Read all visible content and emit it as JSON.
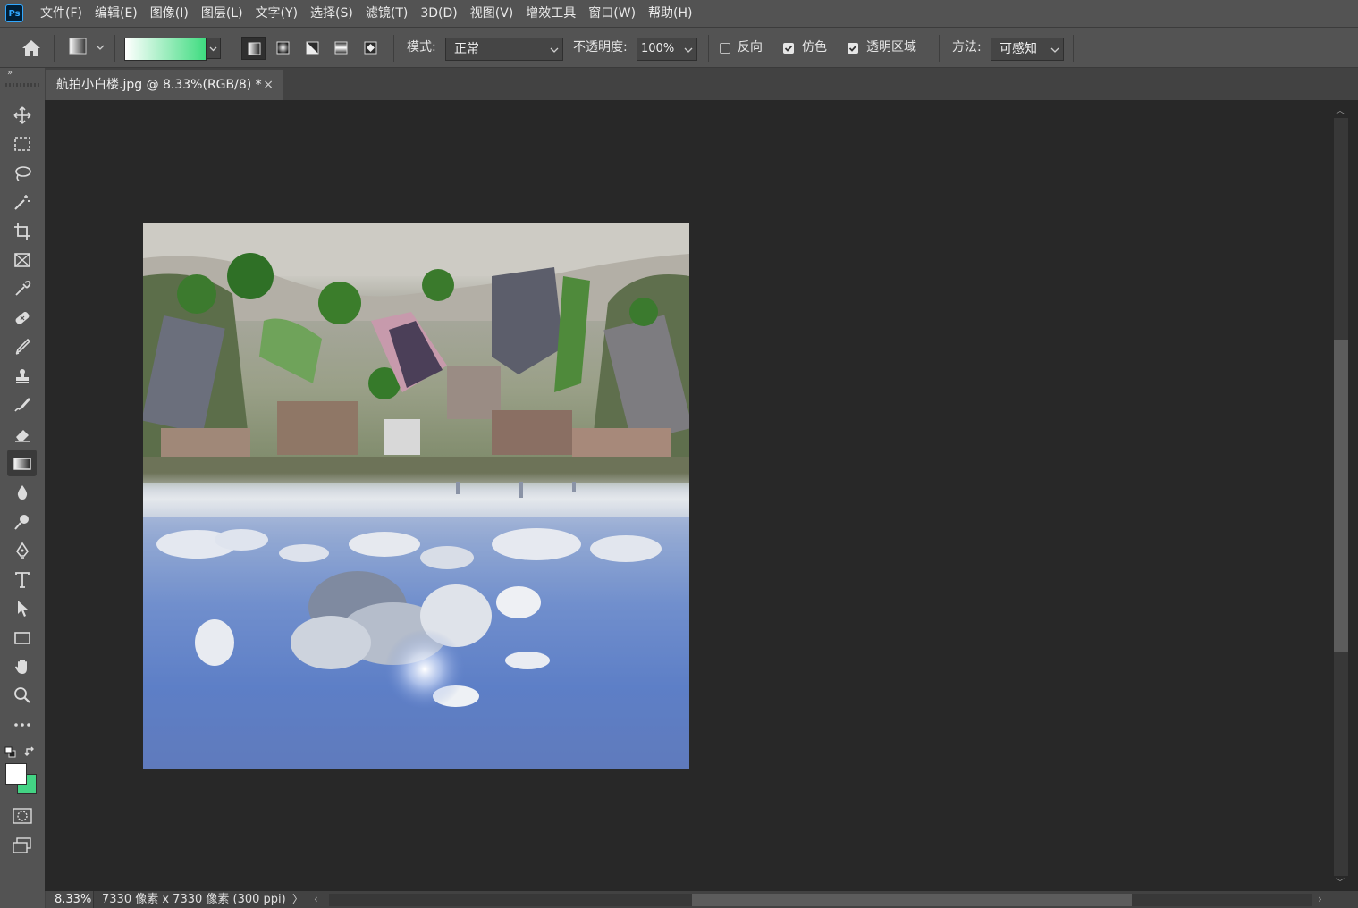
{
  "app": {
    "logo_text": "Ps",
    "menu": [
      "文件(F)",
      "编辑(E)",
      "图像(I)",
      "图层(L)",
      "文字(Y)",
      "选择(S)",
      "滤镜(T)",
      "3D(D)",
      "视图(V)",
      "增效工具",
      "窗口(W)",
      "帮助(H)"
    ]
  },
  "options": {
    "gradient_colors": [
      "#ffffff",
      "#3fdc80"
    ],
    "gradient_types": [
      "linear-gradient-icon",
      "radial-gradient-icon",
      "angle-gradient-icon",
      "reflected-gradient-icon",
      "diamond-gradient-icon"
    ],
    "active_gradient_type": "linear-gradient-icon",
    "mode_label": "模式:",
    "mode_value": "正常",
    "opacity_label": "不透明度:",
    "opacity_value": "100%",
    "reverse_label": "反向",
    "reverse_checked": false,
    "dither_label": "仿色",
    "dither_checked": true,
    "transparency_label": "透明区域",
    "transparency_checked": true,
    "method_label": "方法:",
    "method_value": "可感知"
  },
  "toolbar": {
    "collapse_glyph": "››",
    "tools": [
      "move-tool-icon",
      "marquee-tool-icon",
      "lasso-tool-icon",
      "magic-wand-tool-icon",
      "crop-tool-icon",
      "frame-tool-icon",
      "eyedropper-tool-icon",
      "healing-brush-tool-icon",
      "brush-tool-icon",
      "stamp-tool-icon",
      "history-brush-tool-icon",
      "eraser-tool-icon",
      "gradient-tool-icon",
      "blur-tool-icon",
      "dodge-tool-icon",
      "pen-tool-icon",
      "type-tool-icon",
      "path-selection-tool-icon",
      "rectangle-tool-icon",
      "hand-tool-icon",
      "zoom-tool-icon",
      "more-tools-icon"
    ],
    "active_tool": "gradient-tool-icon",
    "foreground_color": "#ffffff",
    "background_color": "#43d384"
  },
  "document": {
    "tab_title": "航拍小白楼.jpg @ 8.33%(RGB/8) *",
    "close_glyph": "×"
  },
  "status": {
    "zoom": "8.33%",
    "doc_info": "7330 像素 x 7330 像素 (300 ppi)",
    "arrow": "〉",
    "scroll_left": "‹",
    "scroll_right": "›"
  },
  "scrollbars": {
    "up": "︿",
    "down": "﹀"
  }
}
